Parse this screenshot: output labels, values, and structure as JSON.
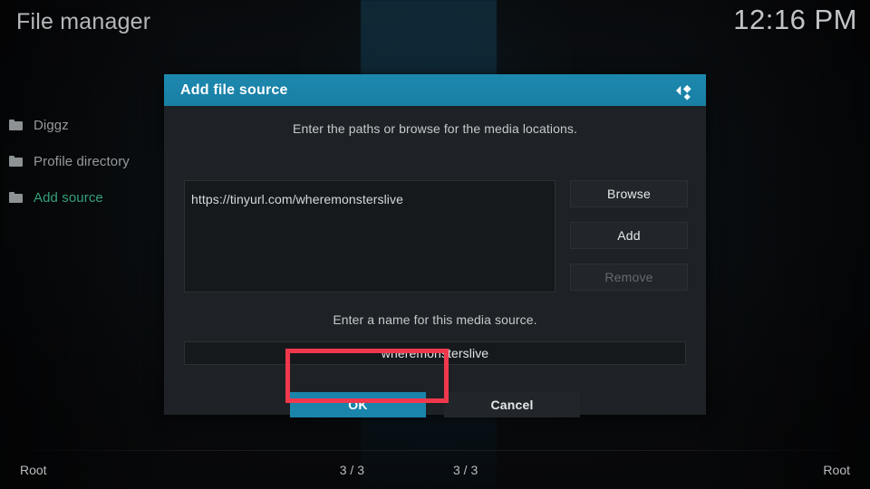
{
  "window": {
    "title": "File manager",
    "clock": "12:16 PM"
  },
  "sidebar": {
    "items": [
      {
        "label": "Diggz",
        "icon": "folder-icon",
        "selected": false
      },
      {
        "label": "Profile directory",
        "icon": "folder-icon",
        "selected": false
      },
      {
        "label": "Add source",
        "icon": "folder-icon",
        "selected": true
      }
    ]
  },
  "status": {
    "left": {
      "path": "Root",
      "count": "3 / 3"
    },
    "right": {
      "count": "3 / 3",
      "path": "Root"
    }
  },
  "dialog": {
    "title": "Add file source",
    "logo_icon": "kodi-logo-icon",
    "paths_hint": "Enter the paths or browse for the media locations.",
    "paths": [
      "https://tinyurl.com/wheremonsterslive"
    ],
    "side_buttons": [
      {
        "label": "Browse",
        "enabled": true
      },
      {
        "label": "Add",
        "enabled": true
      },
      {
        "label": "Remove",
        "enabled": false
      }
    ],
    "name_hint": "Enter a name for this media source.",
    "name_value": "wheremonsterslive",
    "name_placeholder": "Enter a name for this media source.",
    "actions": {
      "ok": "OK",
      "cancel": "Cancel"
    }
  },
  "colors": {
    "accent_teal": "#1b84ab",
    "header_teal": "#1d88ae",
    "dialog_bg": "#1e2226",
    "selected_green": "#35a07a",
    "annotation_red": "#f0384d",
    "text_primary": "#e6e9eb",
    "text_muted": "#96999b",
    "text_disabled": "#64696d"
  }
}
